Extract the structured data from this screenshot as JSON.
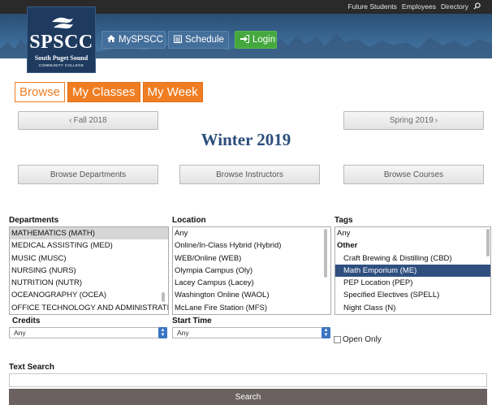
{
  "header": {
    "util_links": [
      "Future Students",
      "Employees",
      "Directory"
    ],
    "logo": {
      "abbr": "SPSCC",
      "line1": "South Puget Sound",
      "line2": "COMMUNITY COLLEGE"
    },
    "nav": {
      "myspscc": "MySPSCC",
      "schedule": "Schedule",
      "login": "Login"
    }
  },
  "tabs": [
    "Browse",
    "My Classes",
    "My Week"
  ],
  "terms": {
    "prev": "Fall 2018",
    "current": "Winter 2019",
    "next": "Spring 2019"
  },
  "browse_buttons": {
    "departments": "Browse Departments",
    "instructors": "Browse Instructors",
    "courses": "Browse Courses"
  },
  "filters": {
    "departments": {
      "label": "Departments",
      "items": [
        "MATHEMATICS (MATH)",
        "MEDICAL ASSISTING (MED)",
        "MUSIC (MUSC)",
        "NURSING (NURS)",
        "NUTRITION (NUTR)",
        "OCEANOGRAPHY (OCEA)",
        "OFFICE TECHNOLOGY AND ADMINISTRATION ("
      ]
    },
    "location": {
      "label": "Location",
      "items": [
        "Any",
        "Online/In-Class Hybrid (Hybrid)",
        "WEB/Online (WEB)",
        "Olympia Campus (Oly)",
        "Lacey Campus (Lacey)",
        "Washington Online (WAOL)",
        "McLane Fire Station (MFS)"
      ]
    },
    "tags": {
      "label": "Tags",
      "items": [
        "Any",
        "Other",
        "Craft Brewing & Distilling (CBD)",
        "Math Emporium (ME)",
        "PEP Location (PEP)",
        "Specified Electives (SPELL)",
        "Night Class (N)"
      ]
    },
    "credits": {
      "label": "Credits",
      "value": "Any"
    },
    "start_time": {
      "label": "Start Time",
      "value": "Any"
    },
    "open_only": "Open Only"
  },
  "text_search": {
    "label": "Text Search",
    "value": ""
  },
  "search_button": "Search",
  "colors": {
    "accent_orange": "#f07d22",
    "navy": "#2c4e7d",
    "login_green": "#44a83e",
    "selected_tag": "#2f4f7f",
    "search_button": "#6b6160"
  }
}
